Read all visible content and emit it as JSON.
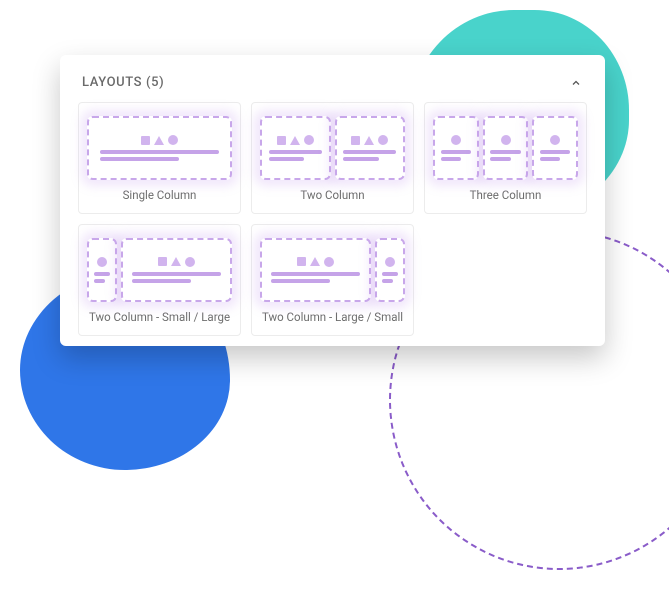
{
  "panel": {
    "title": "LAYOUTS (5)"
  },
  "layouts": {
    "single": "Single Column",
    "two": "Two Column",
    "three": "Three Column",
    "small_large": "Two Column - Small / Large",
    "large_small": "Two Column - Large / Small"
  }
}
